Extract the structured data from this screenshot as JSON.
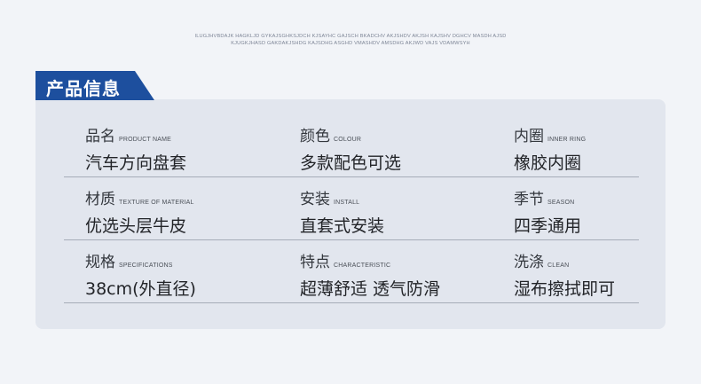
{
  "header": {
    "line1": "ILUGJHVBDAJK HAGKLJD GYKAJSGHKSJDCH KJSAYHC GAJSCH BKADCHV AKJSHDV AKJSH KAJSHV DGHCV MASDH AJSD",
    "line2": "KJUGKJHASD GAKDAKJSHDG KAJSDHG ASGHD VMASHDV AMSDHG AKJWD VAJS VDAMWSYH"
  },
  "section": {
    "title": "产品信息"
  },
  "colors": {
    "tab": "#1d4f9e",
    "panel": "#e2e6ee",
    "line": "#a6acb8",
    "background": "#f2f4f8"
  },
  "rows": [
    [
      {
        "label_cn": "品名",
        "label_en": "PRODUCT NAME",
        "value": "汽车方向盘套"
      },
      {
        "label_cn": "颜色",
        "label_en": "COLOUR",
        "value": "多款配色可选"
      },
      {
        "label_cn": "内圈",
        "label_en": "INNER RING",
        "value": "橡胶内圈"
      }
    ],
    [
      {
        "label_cn": "材质",
        "label_en": "TEXTURE OF MATERIAL",
        "value": "优选头层牛皮"
      },
      {
        "label_cn": "安装",
        "label_en": "INSTALL",
        "value": "直套式安装"
      },
      {
        "label_cn": "季节",
        "label_en": "SEASON",
        "value": "四季通用"
      }
    ],
    [
      {
        "label_cn": "规格",
        "label_en": "SPECIFICATIONS",
        "value": "38cm(外直径)"
      },
      {
        "label_cn": "特点",
        "label_en": "CHARACTERISTIC",
        "value": "超薄舒适 透气防滑"
      },
      {
        "label_cn": "洗涤",
        "label_en": "CLEAN",
        "value": "湿布擦拭即可"
      }
    ]
  ]
}
